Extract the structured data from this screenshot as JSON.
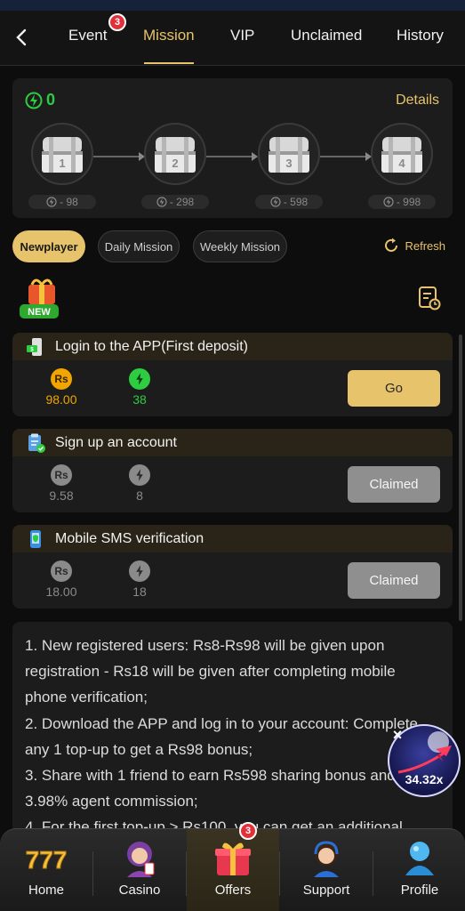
{
  "tabs": [
    {
      "label": "Event",
      "badge": "3"
    },
    {
      "label": "Mission"
    },
    {
      "label": "VIP"
    },
    {
      "label": "Unclaimed"
    },
    {
      "label": "History"
    }
  ],
  "chest_panel": {
    "energy": "0",
    "details_label": "Details",
    "chests": [
      {
        "num": "1",
        "cost": "- 98"
      },
      {
        "num": "2",
        "cost": "- 298"
      },
      {
        "num": "3",
        "cost": "- 598"
      },
      {
        "num": "4",
        "cost": "- 998"
      }
    ]
  },
  "filters": [
    "Newplayer",
    "Daily Mission",
    "Weekly Mission"
  ],
  "refresh_label": "Refresh",
  "new_badge": "NEW",
  "tasks": [
    {
      "title": "Login to the APP(First deposit)",
      "cash": "98.00",
      "energy": "38",
      "button": "Go",
      "state": "active"
    },
    {
      "title": "Sign up an account",
      "cash": "9.58",
      "energy": "8",
      "button": "Claimed",
      "state": "claimed"
    },
    {
      "title": "Mobile SMS verification",
      "cash": "18.00",
      "energy": "18",
      "button": "Claimed",
      "state": "claimed"
    }
  ],
  "currency_symbol": "Rs",
  "rules_text": [
    "1. New registered users: Rs8-Rs98 will be given upon registration - Rs18 will be given after completing mobile phone verification;",
    "2. Download the APP and log in to your account: Complete any 1 top-up to get a Rs98 bonus;",
    "3. Share with 1 friend to earn Rs598 sharing bonus and 3.98% agent commission;",
    "4. For the first top-up > Rs100, you can get an additional"
  ],
  "float_game": {
    "multiplier": "34.32x"
  },
  "bottom_nav": [
    {
      "label": "Home"
    },
    {
      "label": "Casino"
    },
    {
      "label": "Offers",
      "badge": "3"
    },
    {
      "label": "Support"
    },
    {
      "label": "Profile"
    }
  ],
  "colors": {
    "accent": "#e7c36b",
    "energy": "#2ecc40",
    "badge": "#e0303a",
    "cash": "#f0a500"
  }
}
